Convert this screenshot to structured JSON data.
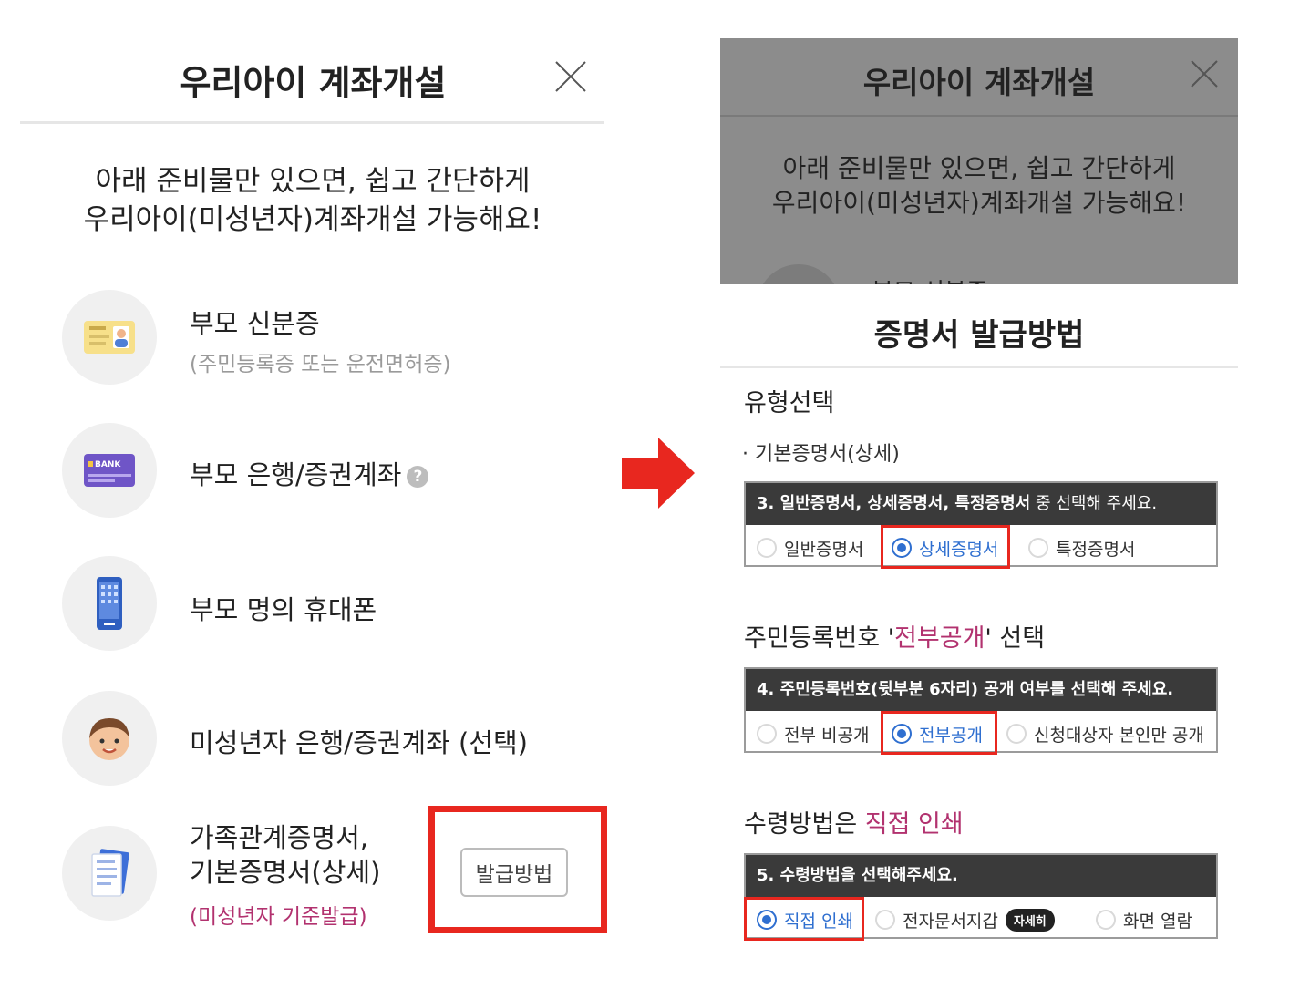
{
  "left": {
    "title": "우리아이 계좌개설",
    "intro_line1": "아래 준비물만 있으면, 쉽고 간단하게",
    "intro_line2": "우리아이(미성년자)계좌개설 가능해요!",
    "items": [
      {
        "label": "부모 신분증",
        "sub": "(주민등록증 또는 운전면허증)",
        "icon": "id-card-icon"
      },
      {
        "label": "부모 은행/증권계좌",
        "help": "?",
        "icon": "bank-card-icon"
      },
      {
        "label": "부모 명의 휴대폰",
        "icon": "phone-icon"
      },
      {
        "label": "미성년자 은행/증권계좌 (선택)",
        "icon": "child-face-icon"
      },
      {
        "label_line1": "가족관계증명서,",
        "label_line2": "기본증명서(상세)",
        "sub": "(미성년자 기준발급)",
        "icon": "document-icon"
      }
    ],
    "issue_button": "발급방법"
  },
  "right": {
    "bg_title": "우리아이 계좌개설",
    "bg_intro_line1": "아래 준비물만 있으면, 쉽고 간단하게",
    "bg_intro_line2": "우리아이(미성년자)계좌개설 가능해요!",
    "bg_item": "부모 신분증",
    "sheet_title": "증명서 발급방법",
    "section1": {
      "title": "유형선택",
      "bullet": "· 기본증명서(상세)",
      "box_head_strong": "3. 일반증명서, 상세증명서, 특정증명서",
      "box_head_rest": " 중 선택해 주세요.",
      "options": [
        "일반증명서",
        "상세증명서",
        "특정증명서"
      ],
      "selected": "상세증명서"
    },
    "section2": {
      "title_prefix": "주민등록번호 '",
      "title_highlight": "전부공개",
      "title_suffix": "' 선택",
      "box_head": "4. 주민등록번호(뒷부분 6자리) 공개 여부를 선택해 주세요.",
      "options": [
        "전부 비공개",
        "전부공개",
        "신청대상자 본인만 공개"
      ],
      "selected": "전부공개"
    },
    "section3": {
      "title_prefix": "수령방법은 ",
      "title_highlight": "직접 인쇄",
      "box_head": "5. 수령방법을 선택해주세요.",
      "options": [
        "직접 인쇄",
        "전자문서지갑",
        "화면 열람"
      ],
      "badge": "자세히",
      "selected": "직접 인쇄"
    }
  },
  "colors": {
    "highlight_red": "#e8271f",
    "accent_pink": "#b2326f",
    "radio_blue": "#2f6fd0",
    "dim_overlay": "#8c8c8c"
  }
}
